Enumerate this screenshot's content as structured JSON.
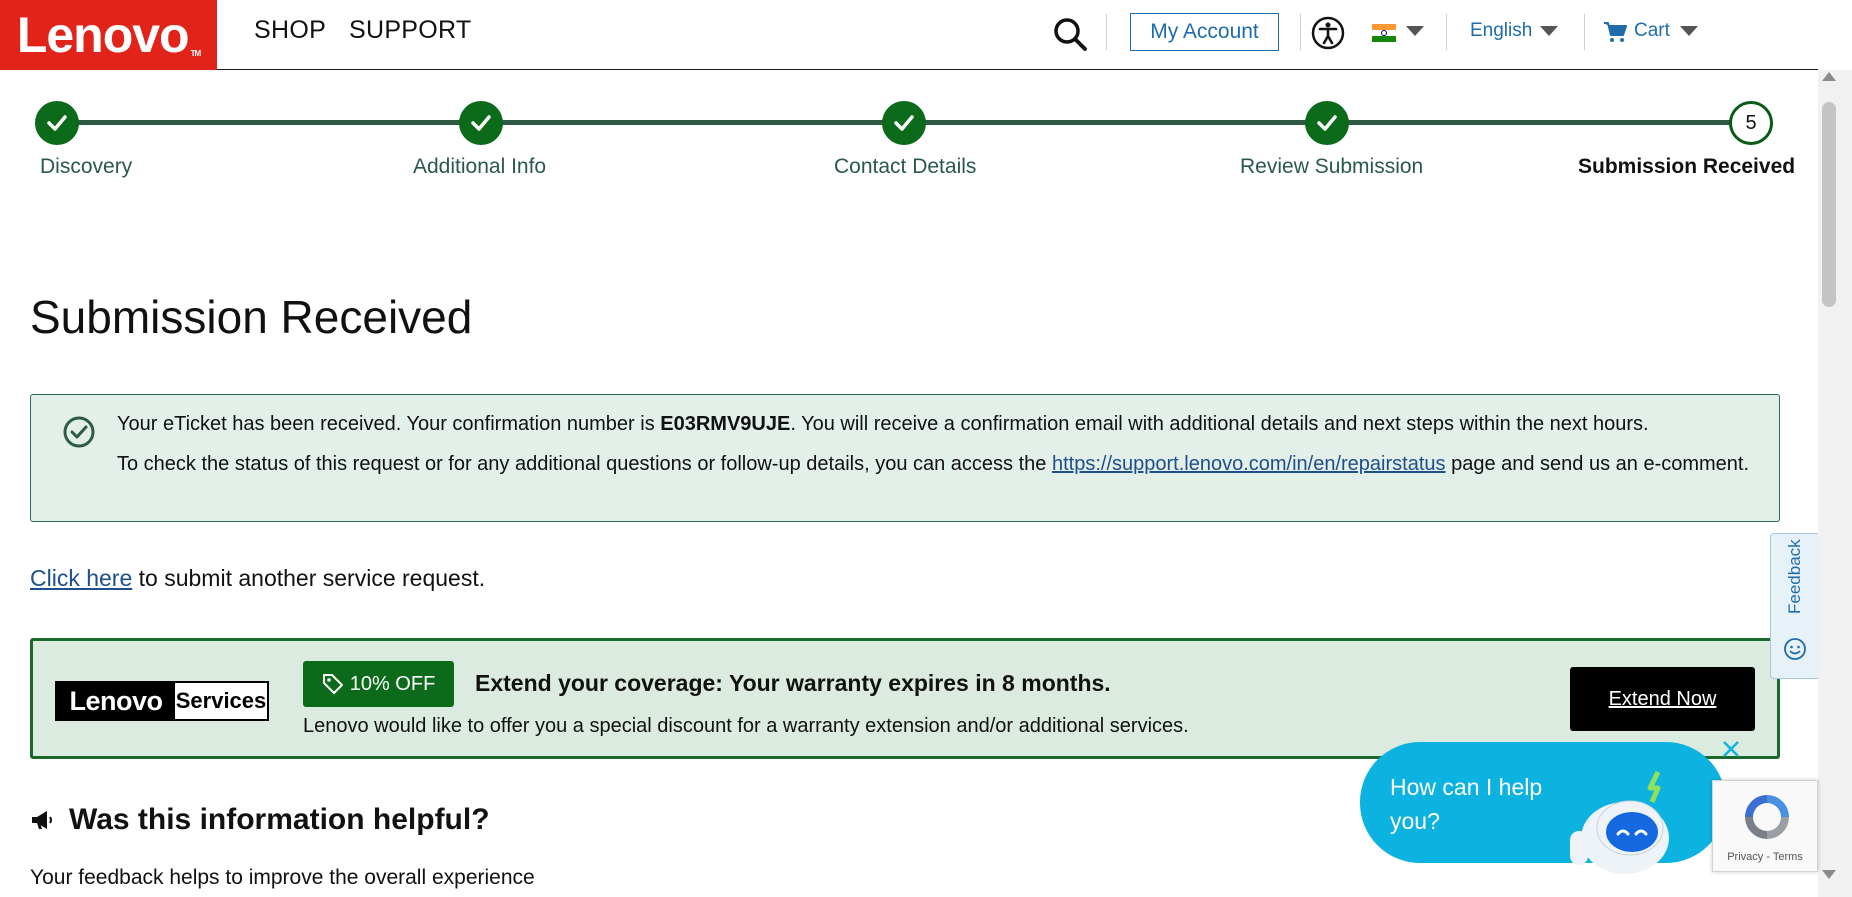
{
  "header": {
    "logo": "Lenovo",
    "logo_tm": "TM",
    "nav": [
      "SHOP",
      "SUPPORT"
    ],
    "my_account": "My Account",
    "language": "English",
    "cart": "Cart"
  },
  "stepper": {
    "steps": [
      "Discovery",
      "Additional Info",
      "Contact Details",
      "Review Submission",
      "Submission Received"
    ],
    "current_number": "5"
  },
  "page_title": "Submission Received",
  "confirmation": {
    "line1_prefix": "Your eTicket has been received. Your confirmation number is ",
    "confirmation_number": "E03RMV9UJE",
    "line1_suffix": ". You will receive a confirmation email with additional details and next steps within the next hours.",
    "line2_prefix": "To check the status of this request or for any additional questions or follow-up details, you can access the ",
    "line2_link": "https://support.lenovo.com/in/en/repairstatus",
    "line2_suffix": " page and send us an e-comment."
  },
  "another_request": {
    "link": "Click here",
    "text": " to submit another service request."
  },
  "services_banner": {
    "logo_left": "Lenovo",
    "logo_right": "Services",
    "badge": "10% OFF",
    "headline": "Extend your coverage: Your warranty expires in 8 months.",
    "subtext": "Lenovo would like to offer you a special discount for a warranty extension and/or additional services.",
    "button": "Extend Now"
  },
  "feedback_tab": "Feedback",
  "helpful": {
    "title": "Was this information helpful?",
    "subtitle": "Your feedback helps to improve the overall experience"
  },
  "chat": {
    "prompt": "How can I help you?"
  },
  "recaptcha": {
    "text": "Privacy - Terms"
  },
  "colors": {
    "brand_red": "#e2231a",
    "step_green": "#0b6b1a",
    "link_blue": "#1f6cad",
    "chat_cyan": "#0cb3e0"
  },
  "icons": [
    "search-icon",
    "accessibility-icon",
    "india-flag-icon",
    "cart-icon",
    "check-icon",
    "check-circle-icon",
    "tag-icon",
    "smile-icon",
    "megaphone-icon",
    "close-icon",
    "robot-icon",
    "recaptcha-icon"
  ]
}
